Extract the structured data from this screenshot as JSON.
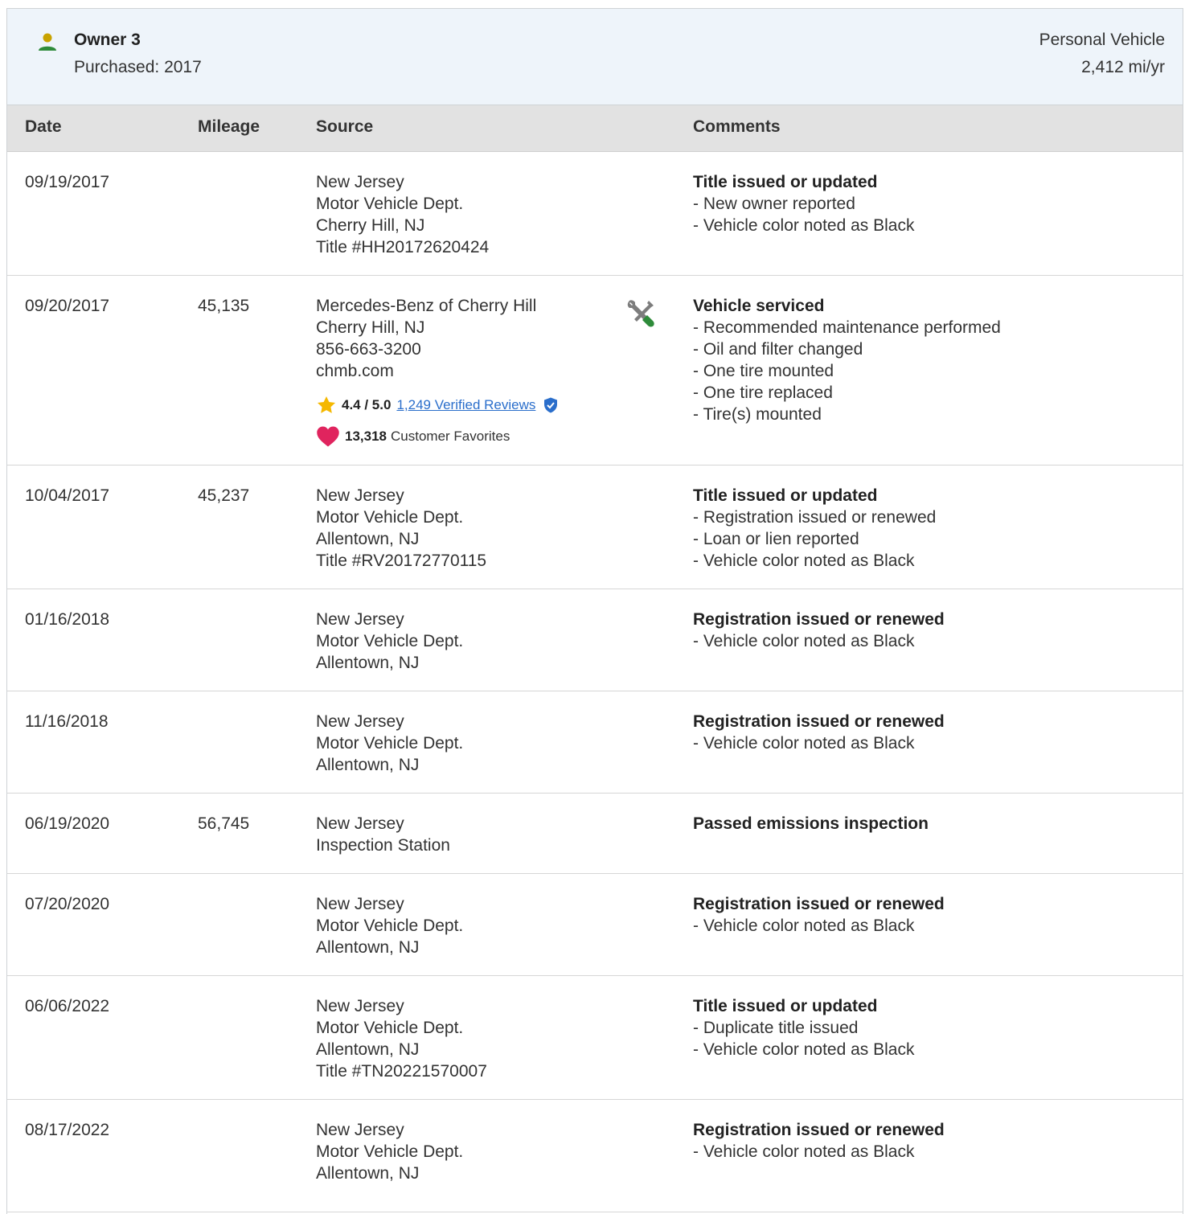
{
  "owner": {
    "name": "Owner 3",
    "purchased": "Purchased: 2017",
    "use_type": "Personal Vehicle",
    "miles_per_year": "2,412 mi/yr",
    "icon": "person-icon",
    "icon_color": "#2e8b3a"
  },
  "table": {
    "headers": {
      "date": "Date",
      "mileage": "Mileage",
      "source": "Source",
      "comments": "Comments"
    },
    "rows": [
      {
        "date": "09/19/2017",
        "mileage": "",
        "source": [
          "New Jersey",
          "Motor Vehicle Dept.",
          "Cherry Hill, NJ",
          "Title #HH20172620424"
        ],
        "comment_title": "Title issued or updated",
        "comment_items": [
          "- New owner reported",
          "- Vehicle color noted as Black"
        ]
      },
      {
        "date": "09/20/2017",
        "mileage": "45,135",
        "source": [
          "Mercedes-Benz of Cherry Hill",
          "Cherry Hill, NJ",
          "856-663-3200",
          "chmb.com"
        ],
        "service_icon": "wrench-screwdriver-icon",
        "rating": {
          "value": "4.4 / 5.0",
          "reviews_link": "1,249 Verified Reviews",
          "star_color": "#f5b800",
          "badge_color": "#2a6ecb"
        },
        "favorites": {
          "count": "13,318",
          "label": "Customer Favorites",
          "heart_color": "#e0245e"
        },
        "comment_title": "Vehicle serviced",
        "comment_items": [
          "- Recommended maintenance performed",
          "- Oil and filter changed",
          "- One tire mounted",
          "- One tire replaced",
          "- Tire(s) mounted"
        ]
      },
      {
        "date": "10/04/2017",
        "mileage": "45,237",
        "source": [
          "New Jersey",
          "Motor Vehicle Dept.",
          "Allentown, NJ",
          "Title #RV20172770115"
        ],
        "comment_title": "Title issued or updated",
        "comment_items": [
          "- Registration issued or renewed",
          "- Loan or lien reported",
          "- Vehicle color noted as Black"
        ]
      },
      {
        "date": "01/16/2018",
        "mileage": "",
        "source": [
          "New Jersey",
          "Motor Vehicle Dept.",
          "Allentown, NJ"
        ],
        "comment_title": "Registration issued or renewed",
        "comment_items": [
          "- Vehicle color noted as Black"
        ]
      },
      {
        "date": "11/16/2018",
        "mileage": "",
        "source": [
          "New Jersey",
          "Motor Vehicle Dept.",
          "Allentown, NJ"
        ],
        "comment_title": "Registration issued or renewed",
        "comment_items": [
          "- Vehicle color noted as Black"
        ]
      },
      {
        "date": "06/19/2020",
        "mileage": "56,745",
        "source": [
          "New Jersey",
          "Inspection Station"
        ],
        "comment_title": "Passed emissions inspection",
        "comment_items": []
      },
      {
        "date": "07/20/2020",
        "mileage": "",
        "source": [
          "New Jersey",
          "Motor Vehicle Dept.",
          "Allentown, NJ"
        ],
        "comment_title": "Registration issued or renewed",
        "comment_items": [
          "- Vehicle color noted as Black"
        ]
      },
      {
        "date": "06/06/2022",
        "mileage": "",
        "source": [
          "New Jersey",
          "Motor Vehicle Dept.",
          "Allentown, NJ",
          "Title #TN20221570007"
        ],
        "comment_title": "Title issued or updated",
        "comment_items": [
          "- Duplicate title issued",
          "- Vehicle color noted as Black"
        ]
      },
      {
        "date": "08/17/2022",
        "mileage": "",
        "source": [
          "New Jersey",
          "Motor Vehicle Dept.",
          "Allentown, NJ"
        ],
        "comment_title": "Registration issued or renewed",
        "comment_items": [
          "- Vehicle color noted as Black"
        ]
      }
    ]
  }
}
